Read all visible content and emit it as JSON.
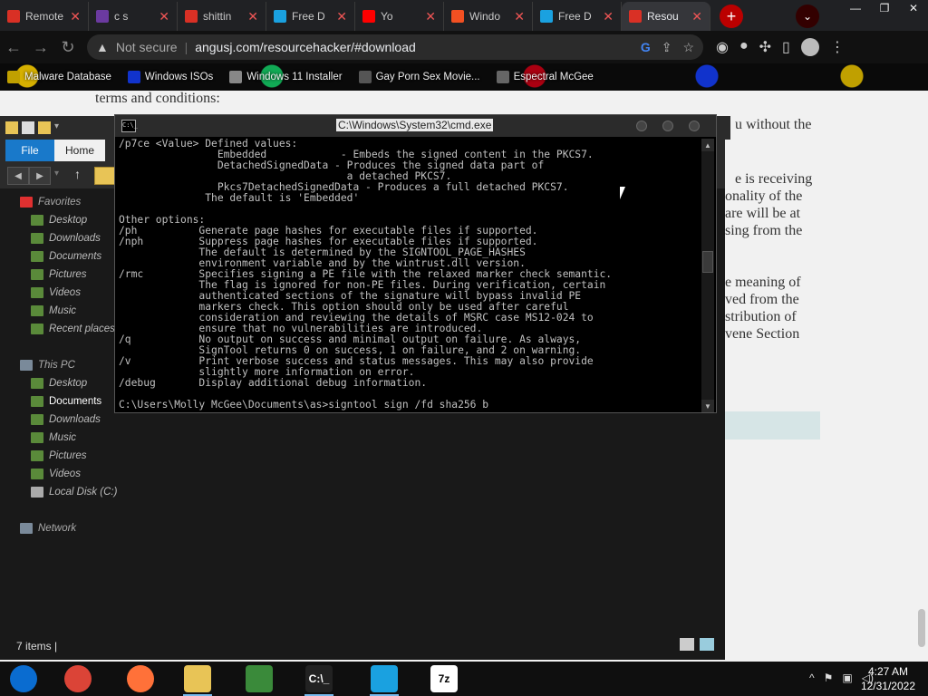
{
  "browser": {
    "tabs": [
      {
        "title": "Remote",
        "color": "#d93025",
        "active": false
      },
      {
        "title": "c s",
        "color": "#6b3aa0",
        "active": false
      },
      {
        "title": "shittin",
        "color": "#d93025",
        "active": false
      },
      {
        "title": "Free D",
        "color": "#1aa1e0",
        "active": false
      },
      {
        "title": "Yo",
        "color": "#ff0000",
        "active": false
      },
      {
        "title": "Windo",
        "color": "#f25022",
        "active": false
      },
      {
        "title": "Free D",
        "color": "#1aa1e0",
        "active": false
      },
      {
        "title": "Resou",
        "color": "#d93025",
        "active": true
      }
    ],
    "new_tab": "+",
    "security_label": "Not secure",
    "url": "angusj.com/resourcehacker/#download",
    "bookmarks": [
      {
        "label": "Malware Database",
        "color": "#c0a000"
      },
      {
        "label": "Windows ISOs",
        "color": "#1133cc"
      },
      {
        "label": "Windows 11 Installer",
        "color": "#888888"
      },
      {
        "label": "Gay Porn Sex Movie...",
        "color": "#555555"
      },
      {
        "label": "Espectral McGee",
        "color": "#666666"
      }
    ]
  },
  "webpage": {
    "lines": [
      "terms and conditions:",
      "u without the",
      "e is receiving",
      "onality of the",
      "are will be at",
      "sing from the",
      "e meaning of",
      "ved from the",
      "stribution of",
      "vene Section"
    ]
  },
  "explorer": {
    "ribbon_file": "File",
    "ribbon_home": "Home",
    "nav": [
      {
        "label": "Favorites",
        "type": "header"
      },
      {
        "label": "Desktop"
      },
      {
        "label": "Downloads"
      },
      {
        "label": "Documents"
      },
      {
        "label": "Pictures"
      },
      {
        "label": "Videos"
      },
      {
        "label": "Music"
      },
      {
        "label": "Recent places"
      },
      {
        "label": "This PC",
        "type": "header"
      },
      {
        "label": "Desktop"
      },
      {
        "label": "Documents",
        "selected": true
      },
      {
        "label": "Downloads"
      },
      {
        "label": "Music"
      },
      {
        "label": "Pictures"
      },
      {
        "label": "Videos"
      },
      {
        "label": "Local Disk (C:)"
      },
      {
        "label": "Network",
        "type": "header"
      }
    ],
    "status": "7 items  |"
  },
  "cmd": {
    "title": "C:\\Windows\\System32\\cmd.exe",
    "lines": [
      "/p7ce <Value> Defined values:",
      "                Embedded            - Embeds the signed content in the PKCS7.",
      "                DetachedSignedData - Produces the signed data part of",
      "                                     a detached PKCS7.",
      "                Pkcs7DetachedSignedData - Produces a full detached PKCS7.",
      "              The default is 'Embedded'",
      "",
      "Other options:",
      "/ph          Generate page hashes for executable files if supported.",
      "/nph         Suppress page hashes for executable files if supported.",
      "             The default is determined by the SIGNTOOL_PAGE_HASHES",
      "             environment variable and by the wintrust.dll version.",
      "/rmc         Specifies signing a PE file with the relaxed marker check semantic.",
      "             The flag is ignored for non-PE files. During verification, certain",
      "             authenticated sections of the signature will bypass invalid PE",
      "             markers check. This option should only be used after careful",
      "             consideration and reviewing the details of MSRC case MS12-024 to",
      "             ensure that no vulnerabilities are introduced.",
      "/q           No output on success and minimal output on failure. As always,",
      "             SignTool returns 0 on success, 1 on failure, and 2 on warning.",
      "/v           Print verbose success and status messages. This may also provide",
      "             slightly more information on error.",
      "/debug       Display additional debug information.",
      "",
      "C:\\Users\\Molly McGee\\Documents\\as>signtool sign /fd sha256 b"
    ]
  },
  "taskbar": {
    "items": [
      {
        "icon": "start-icon",
        "color": "#0a6cd0"
      },
      {
        "icon": "chrome-icon",
        "color": "#db4437"
      },
      {
        "icon": "firefox-icon",
        "color": "#ff7139"
      },
      {
        "icon": "file-explorer-icon",
        "color": "#e8c456"
      },
      {
        "icon": "people-icon",
        "color": "#3a8a3a"
      },
      {
        "icon": "cmd-icon",
        "color": "#222222",
        "label": "C:\\_"
      },
      {
        "icon": "share-icon",
        "color": "#1aa1e0"
      },
      {
        "icon": "7zip-icon",
        "color": "#ffffff",
        "label": "7z"
      }
    ],
    "tray_chevron": "^",
    "time": "4:27 AM",
    "date": "12/31/2022"
  }
}
